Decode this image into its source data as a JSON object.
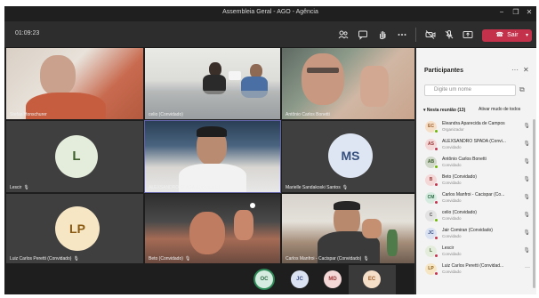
{
  "window": {
    "title": "Assembleia Geral - AGO - Agência",
    "minimize": "−",
    "maximize": "❐",
    "close": "✕"
  },
  "toolbar": {
    "timer": "01:09:23",
    "leave_label": "Sair",
    "leave_color": "#c4314b"
  },
  "tiles": [
    {
      "name": "Stefan Honschurer"
    },
    {
      "name": "celio (Convidado)"
    },
    {
      "name": "Antônio Carlos Bonetti"
    },
    {
      "name": "Lescir",
      "initials": "L"
    },
    {
      "name": "ALEXSANDRO SPADA (Convidado)"
    },
    {
      "name": "Marielle Sandakoski Santos",
      "initials": "MS"
    },
    {
      "name": "Luiz Carlos Peretti (Convidado)",
      "initials": "LP"
    },
    {
      "name": "Beto (Convidado)"
    },
    {
      "name": "Carlos Manfroi - Cacispar (Convidado)"
    }
  ],
  "bottom_avatars": [
    "OC",
    "JC",
    "MD",
    "EC"
  ],
  "panel": {
    "title": "Participantes",
    "search_placeholder": "Digite um nome",
    "section_label": "Nesta reunião (13)",
    "mute_all_label": "Ativar mudo de todos",
    "participants": [
      {
        "initials": "EC",
        "name": "Eleandra Aparecida de Campos",
        "role": "Organizador"
      },
      {
        "initials": "AS",
        "name": "ALEXSANDRO SPADA (Convi...",
        "role": "Convidado"
      },
      {
        "initials": "AB",
        "name": "Antônio Carlos Bonetti",
        "role": "Convidado"
      },
      {
        "initials": "B",
        "name": "Beto (Convidado)",
        "role": "Convidado"
      },
      {
        "initials": "CM",
        "name": "Carlos Manfroi - Cacispar (Co...",
        "role": "Convidado"
      },
      {
        "initials": "C",
        "name": "celio (Convidado)",
        "role": "Convidado"
      },
      {
        "initials": "JC",
        "name": "Jair Comiran (Convidado)",
        "role": "Convidado"
      },
      {
        "initials": "L",
        "name": "Lescir",
        "role": "Convidado"
      },
      {
        "initials": "LP",
        "name": "Luiz Carlos Peretti (Convidad...",
        "role": "Convidado"
      }
    ]
  }
}
